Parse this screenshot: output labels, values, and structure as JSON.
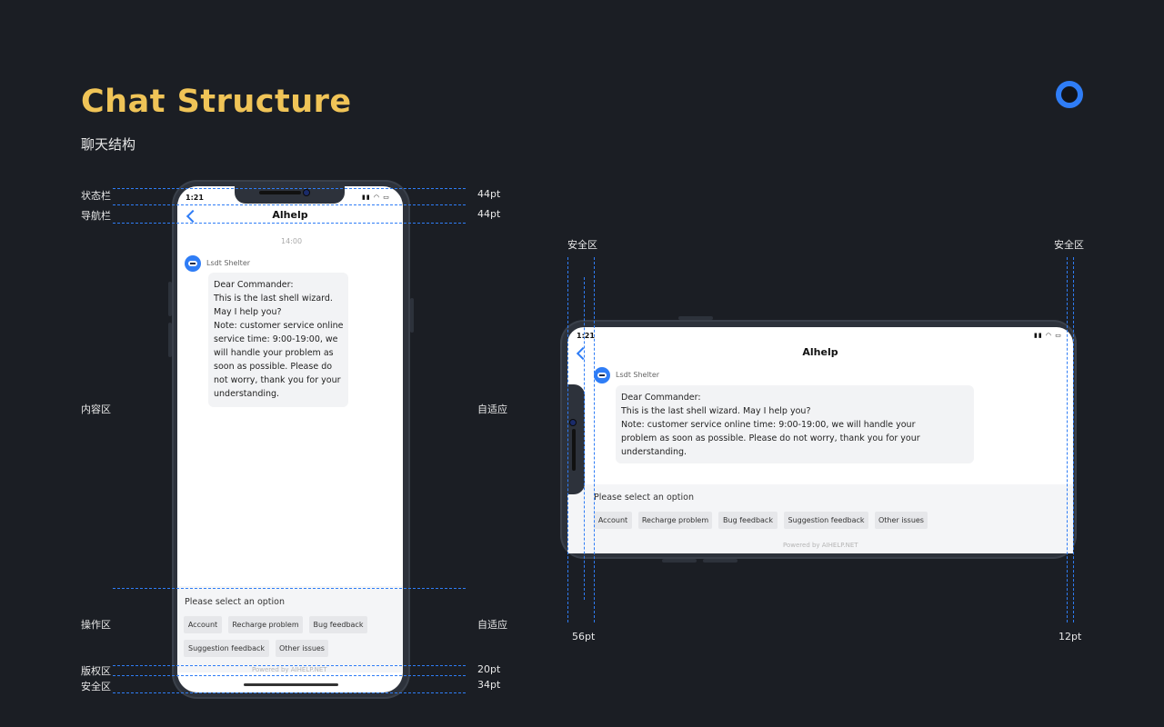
{
  "header": {
    "title": "Chat Structure",
    "subtitle": "聊天结构"
  },
  "colors": {
    "background": "#1b1e24",
    "title": "#f0c457",
    "accent": "#2f7df6"
  },
  "portrait": {
    "left_labels": {
      "status_bar": "状态栏",
      "nav_bar": "导航栏",
      "content_area": "内容区",
      "operation_area": "操作区",
      "copyright_area": "版权区",
      "safe_area": "安全区"
    },
    "right_labels": {
      "status_bar": "44pt",
      "nav_bar": "44pt",
      "content_area": "自适应",
      "operation_area": "自适应",
      "copyright_area": "20pt",
      "safe_area": "34pt"
    },
    "status_time": "1:21",
    "status_icons": "signal-wifi-battery-icons",
    "nav_title": "Alhelp",
    "timestamp": "14:00",
    "sender": "Lsdt Shelter",
    "message_lines": [
      "Dear Commander:",
      "This is the last shell wizard.",
      "May I help you?",
      "Note: customer service online",
      "service time: 9:00-19:00, we",
      "will handle your problem as",
      "soon as possible. Please do",
      "not worry, thank you for your",
      "understanding."
    ],
    "options_title": "Please select an option",
    "options": [
      "Account",
      "Recharge problem",
      "Bug feedback",
      "Suggestion feedback",
      "Other issues"
    ],
    "powered": "Powered by AIHELP.NET"
  },
  "landscape": {
    "top_left_label": "安全区",
    "top_right_label": "安全区",
    "bottom_left_label": "56pt",
    "bottom_right_label": "12pt",
    "status_time": "1:21",
    "nav_title": "Alhelp",
    "sender": "Lsdt Shelter",
    "message_lines": [
      "Dear Commander:",
      "This is the last shell wizard. May I help you?",
      "Note: customer service online time: 9:00-19:00, we will handle your",
      "problem as soon as possible. Please do not worry, thank you for your",
      "understanding."
    ],
    "options_title": "Please select an option",
    "options": [
      "Account",
      "Recharge problem",
      "Bug feedback",
      "Suggestion feedback",
      "Other issues"
    ],
    "powered": "Powered by AIHELP.NET"
  }
}
